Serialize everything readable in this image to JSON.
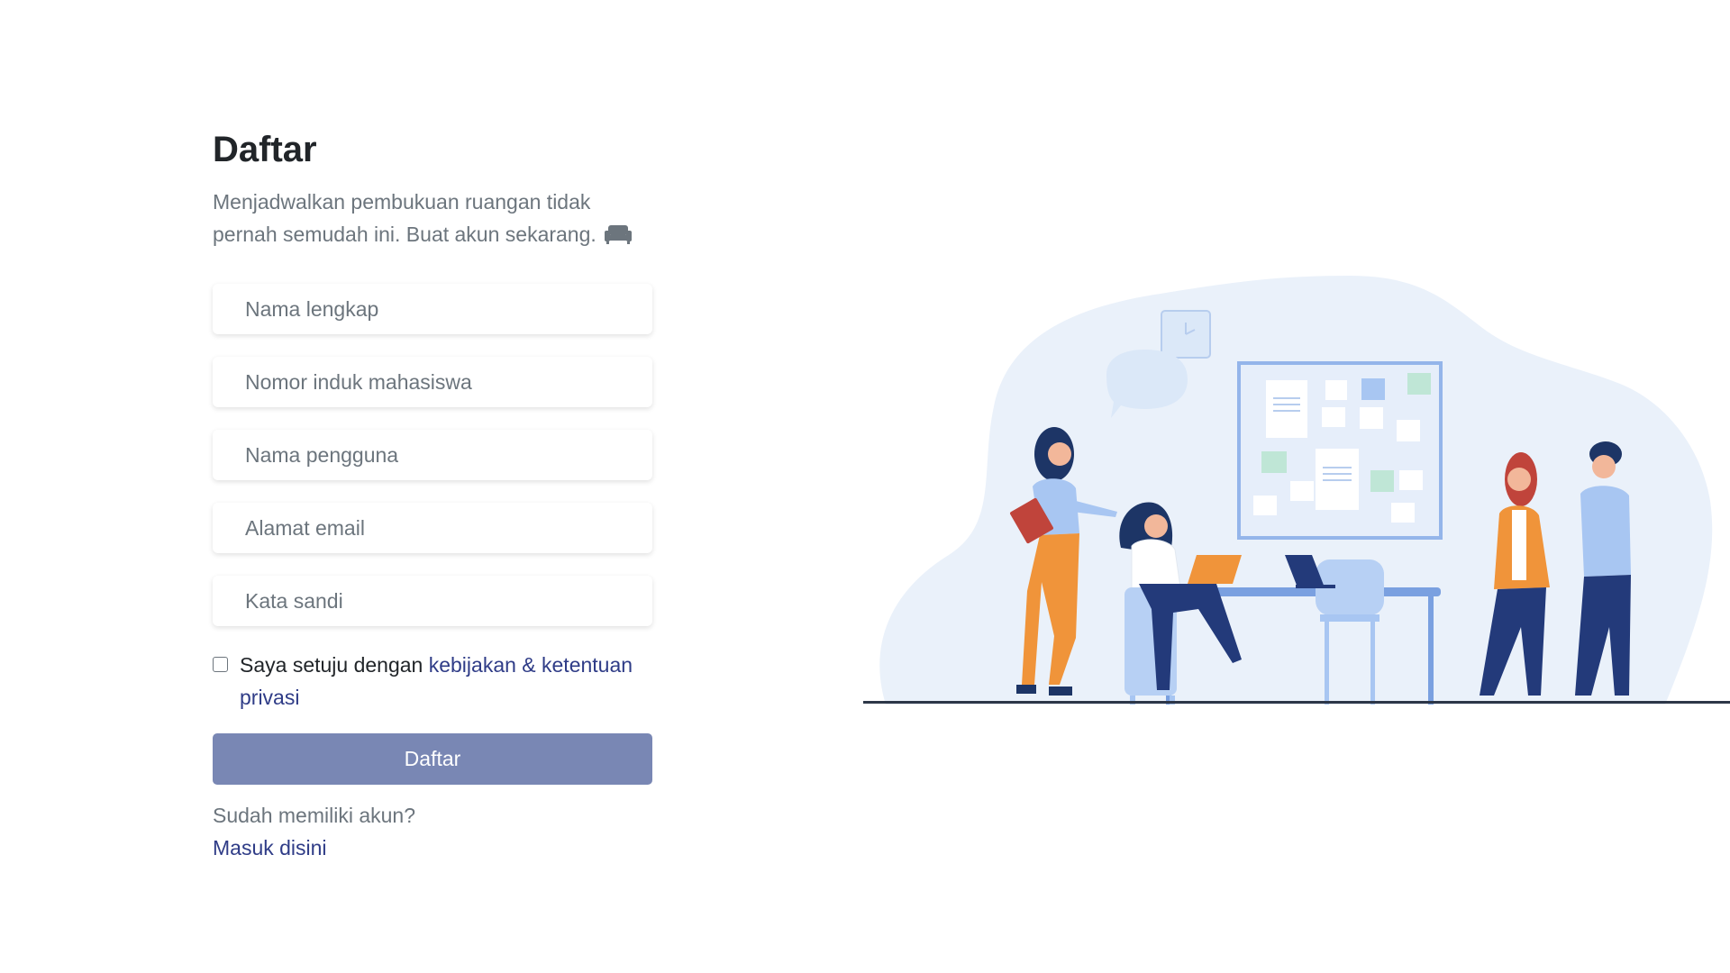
{
  "form": {
    "title": "Daftar",
    "subtitle": "Menjadwalkan pembukuan ruangan tidak pernah semudah ini. Buat akun sekarang.",
    "fields": {
      "full_name_placeholder": "Nama lengkap",
      "student_id_placeholder": "Nomor induk mahasiswa",
      "username_placeholder": "Nama pengguna",
      "email_placeholder": "Alamat email",
      "password_placeholder": "Kata sandi"
    },
    "agree_prefix": "Saya setuju dengan ",
    "agree_link": "kebijakan & ketentuan privasi",
    "submit_label": "Daftar",
    "login_hint": "Sudah memiliki akun?",
    "login_link": "Masuk disini"
  },
  "colors": {
    "accent": "#2f3c87",
    "button": "#7987b4",
    "muted_text": "#6c757d",
    "illustration_blob": "#eaf1fa"
  },
  "icons": {
    "subtitle_icon": "sofa-icon"
  }
}
